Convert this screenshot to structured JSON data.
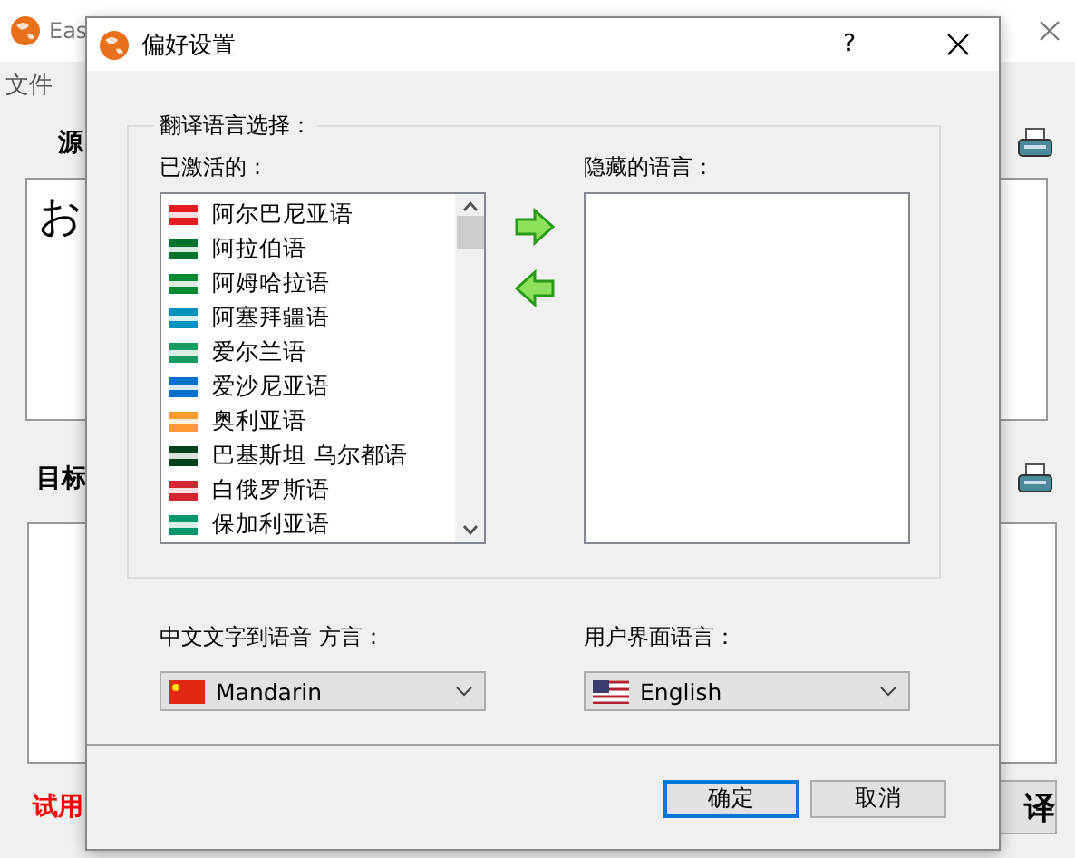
{
  "background_window": {
    "title": "Eas",
    "menu": [
      "文件"
    ],
    "source_label": "源",
    "source_text": "お",
    "target_label": "目标",
    "trial_notice": "试用",
    "translate_button": "译"
  },
  "dialog": {
    "title": "偏好设置",
    "help": "?",
    "group_title": "翻译语言选择：",
    "active_label": "已激活的：",
    "active_languages": [
      {
        "name": "阿尔巴尼亚语",
        "color": "#e41e20"
      },
      {
        "name": "阿拉伯语",
        "color": "#00732f"
      },
      {
        "name": "阿姆哈拉语",
        "color": "#078930"
      },
      {
        "name": "阿塞拜疆语",
        "color": "#0092bc"
      },
      {
        "name": "爱尔兰语",
        "color": "#169b62"
      },
      {
        "name": "爱沙尼亚语",
        "color": "#0072ce"
      },
      {
        "name": "奥利亚语",
        "color": "#ff9933"
      },
      {
        "name": "巴基斯坦 乌尔都语",
        "color": "#01411c"
      },
      {
        "name": "白俄罗斯语",
        "color": "#d22730"
      },
      {
        "name": "保加利亚语",
        "color": "#00966e"
      }
    ],
    "hidden_label": "隐藏的语言：",
    "tts_label": "中文文字到语音 方言：",
    "tts_dialect": "Mandarin",
    "ui_label": "用户界面语言：",
    "ui_language": "English",
    "buttons": [
      {
        "label": "确定",
        "default": true
      },
      {
        "label": "取消",
        "default": false
      }
    ]
  }
}
